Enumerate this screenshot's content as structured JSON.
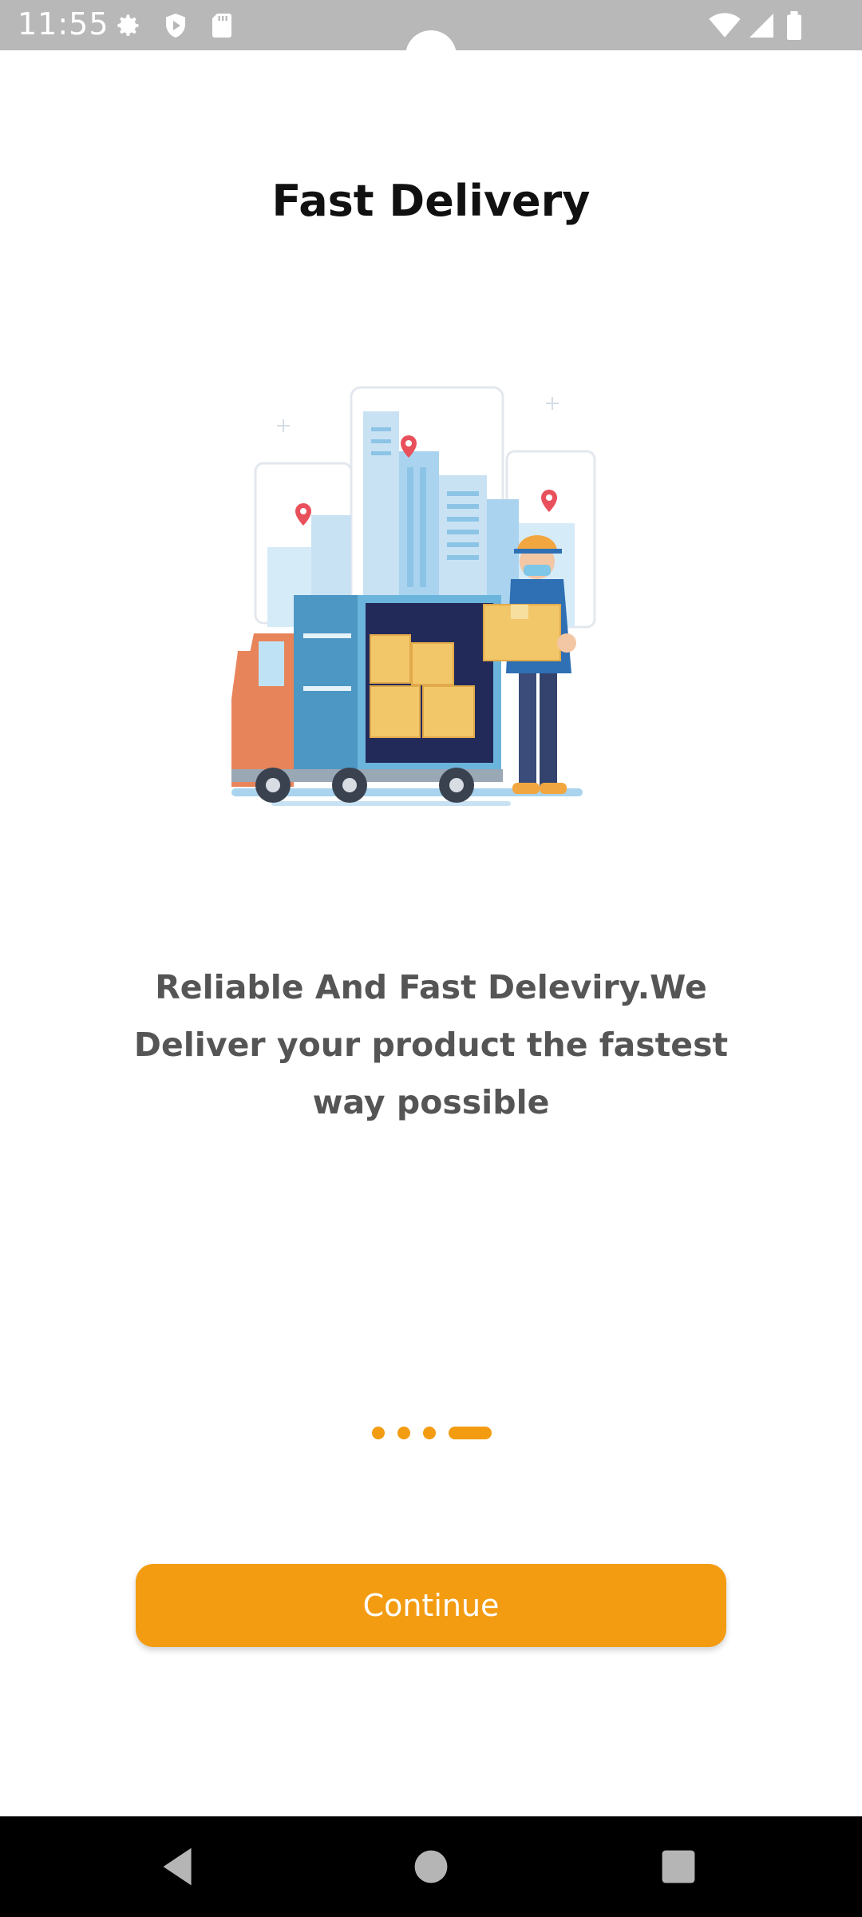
{
  "status_bar": {
    "time": "11:55",
    "left_icons": [
      "gear-icon",
      "shield-play-icon",
      "sd-card-icon"
    ],
    "right_icons": [
      "wifi-icon",
      "signal-icon",
      "battery-icon"
    ]
  },
  "screen": {
    "title": "Fast Delivery",
    "description": "Reliable And Fast Deleviry.We Deliver your product the fastest way possible",
    "pager": {
      "total": 4,
      "active_index": 3
    },
    "continue_label": "Continue"
  },
  "nav_bar": {
    "buttons": [
      "back-icon",
      "home-icon",
      "recents-icon"
    ]
  },
  "colors": {
    "accent": "#f39c12",
    "status_bar": "#b8b8b8",
    "title": "#111111",
    "body_text": "#555555"
  }
}
